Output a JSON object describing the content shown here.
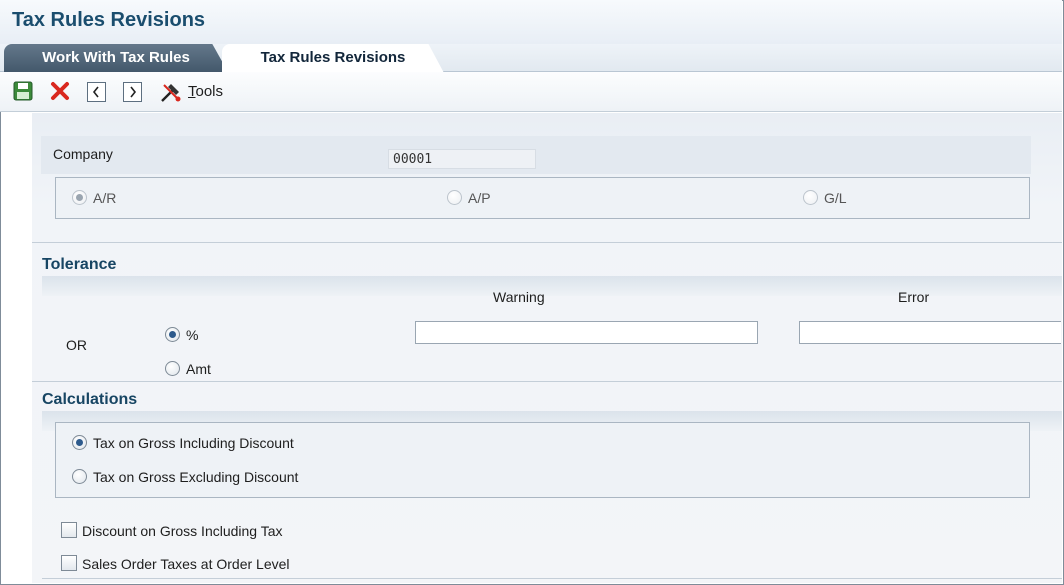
{
  "window": {
    "title": "Tax Rules Revisions"
  },
  "tabs": [
    {
      "label": "Work With Tax Rules",
      "active": false
    },
    {
      "label": "Tax Rules Revisions",
      "active": true
    }
  ],
  "toolbar": {
    "save_icon": "save-icon",
    "cancel_icon": "cancel-x-icon",
    "prev_icon": "previous-icon",
    "next_icon": "next-icon",
    "tools_prefix": "",
    "tools_underlined": "T",
    "tools_rest": "ools"
  },
  "form": {
    "company_label": "Company",
    "company_value": "00001",
    "ledger_options": [
      {
        "label": "A/R",
        "selected": true
      },
      {
        "label": "A/P",
        "selected": false
      },
      {
        "label": "G/L",
        "selected": false
      }
    ],
    "tolerance": {
      "title": "Tolerance",
      "warning_header": "Warning",
      "error_header": "Error",
      "or_label": "OR",
      "options": [
        {
          "label": "%",
          "selected": true
        },
        {
          "label": "Amt",
          "selected": false
        }
      ],
      "warning_value": "",
      "error_value": ""
    },
    "calculations": {
      "title": "Calculations",
      "options": [
        {
          "label": "Tax on Gross Including Discount",
          "selected": true
        },
        {
          "label": "Tax on Gross Excluding Discount",
          "selected": false
        }
      ],
      "checkboxes": [
        {
          "label": "Discount on Gross Including Tax",
          "checked": false
        },
        {
          "label": "Sales Order Taxes at Order Level",
          "checked": false
        }
      ]
    }
  },
  "colors": {
    "title": "#1a4d6e",
    "section_title": "#174563",
    "tab_inactive": "#4e6377",
    "cancel_red": "#d9281f",
    "save_green": "#3c8a3a"
  }
}
